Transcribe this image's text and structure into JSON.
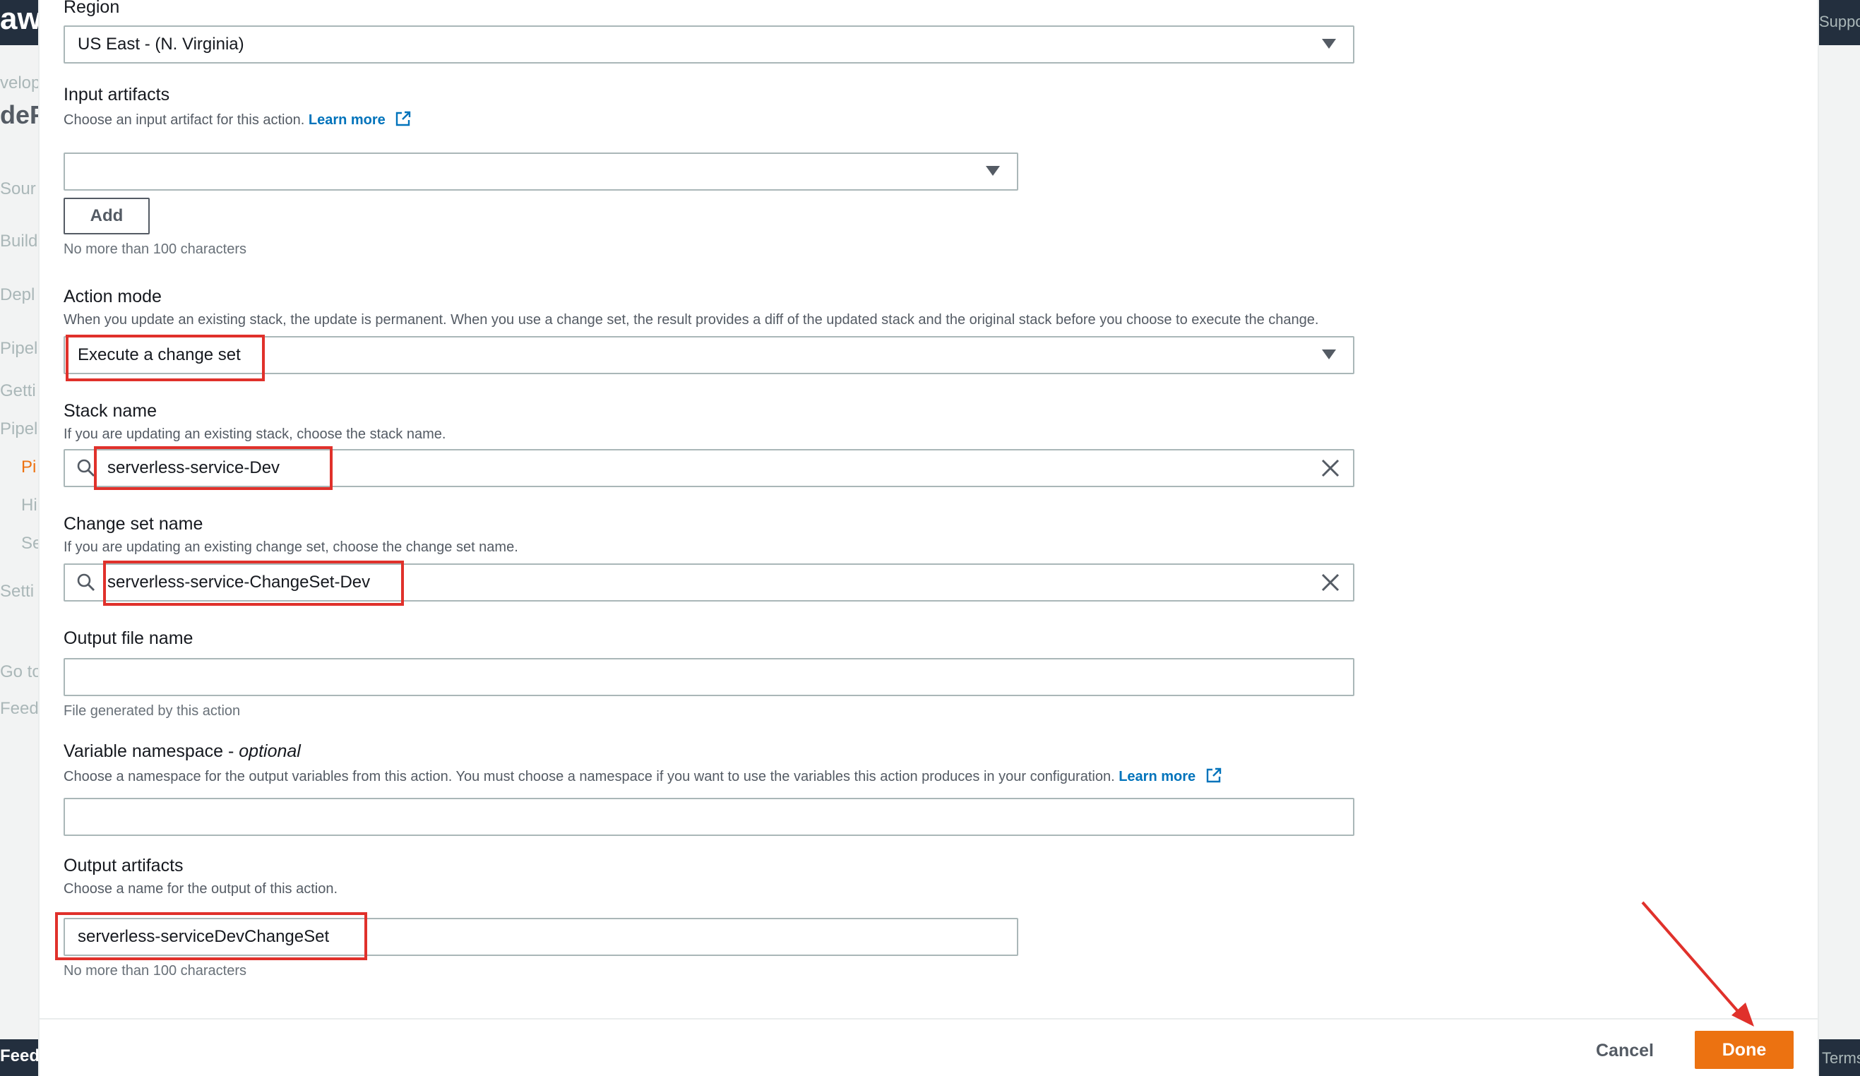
{
  "background": {
    "logo": "aws",
    "nav": [
      {
        "label": "velop"
      },
      {
        "label": "deP"
      },
      {
        "label": "Sour"
      },
      {
        "label": "Build"
      },
      {
        "label": "Depl"
      },
      {
        "label": "Pipel"
      },
      {
        "label": "Getti"
      },
      {
        "label": "Pipel"
      },
      {
        "label": "Pi"
      },
      {
        "label": "Hi"
      },
      {
        "label": "Se"
      },
      {
        "label": "Setti"
      },
      {
        "label": "Go to"
      },
      {
        "label": "Feed"
      }
    ],
    "feedback": "Feedb",
    "support": "Support",
    "terms": "Terms"
  },
  "form": {
    "region": {
      "label": "Region",
      "value": "US East - (N. Virginia)"
    },
    "input_artifacts": {
      "label": "Input artifacts",
      "desc": "Choose an input artifact for this action.",
      "learn_more": "Learn more",
      "value": "",
      "add_label": "Add",
      "hint": "No more than 100 characters"
    },
    "action_mode": {
      "label": "Action mode",
      "desc": "When you update an existing stack, the update is permanent. When you use a change set, the result provides a diff of the updated stack and the original stack before you choose to execute the change.",
      "value": "Execute a change set"
    },
    "stack_name": {
      "label": "Stack name",
      "desc": "If you are updating an existing stack, choose the stack name.",
      "value": "serverless-service-Dev"
    },
    "change_set_name": {
      "label": "Change set name",
      "desc": "If you are updating an existing change set, choose the change set name.",
      "value": "serverless-service-ChangeSet-Dev"
    },
    "output_file": {
      "label": "Output file name",
      "value": "",
      "hint": "File generated by this action"
    },
    "variable_namespace": {
      "label": "Variable namespace - ",
      "label_optional": "optional",
      "desc": "Choose a namespace for the output variables from this action. You must choose a namespace if you want to use the variables this action produces in your configuration.",
      "learn_more": "Learn more",
      "value": ""
    },
    "output_artifacts": {
      "label": "Output artifacts",
      "desc": "Choose a name for the output of this action.",
      "value": "serverless-serviceDevChangeSet",
      "hint": "No more than 100 characters"
    }
  },
  "footer": {
    "cancel_label": "Cancel",
    "done_label": "Done"
  },
  "colors": {
    "accent": "#ec7211",
    "link": "#0073bb",
    "highlight": "#e0312b"
  }
}
